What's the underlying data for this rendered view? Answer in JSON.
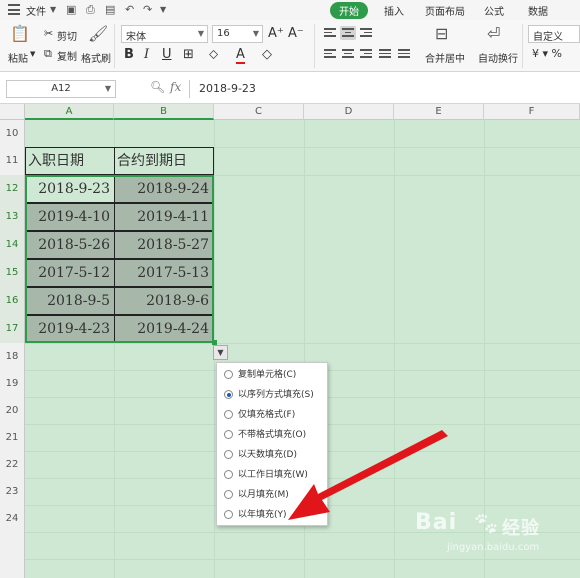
{
  "menubar": {
    "file_label": "文件",
    "tabs": [
      "开始",
      "插入",
      "页面布局",
      "公式",
      "数据"
    ]
  },
  "ribbon": {
    "paste_label": "粘贴",
    "cut_label": "剪切",
    "copy_label": "复制",
    "format_painter_label": "格式刷",
    "font_name": "宋体",
    "font_size": "16",
    "bold": "B",
    "italic": "I",
    "underline": "U",
    "merge_center_label": "合并居中",
    "wrap_text_label": "自动换行",
    "number_format": "自定义"
  },
  "formula_bar": {
    "name_box": "A12",
    "fx": "fx",
    "formula": "2018-9-23"
  },
  "columns": [
    "A",
    "B",
    "C",
    "D",
    "E",
    "F"
  ],
  "rows": [
    "10",
    "11",
    "12",
    "13",
    "14",
    "15",
    "16",
    "17",
    "18",
    "19",
    "20",
    "21",
    "22",
    "23",
    "24"
  ],
  "table": {
    "headers": [
      "入职日期",
      "合约到期日"
    ],
    "rows": [
      [
        "2018-9-23",
        "2018-9-24"
      ],
      [
        "2019-4-10",
        "2019-4-11"
      ],
      [
        "2018-5-26",
        "2018-5-27"
      ],
      [
        "2017-5-12",
        "2017-5-13"
      ],
      [
        "2018-9-5",
        "2018-9-6"
      ],
      [
        "2019-4-23",
        "2019-4-24"
      ]
    ]
  },
  "autofill_menu": {
    "options": [
      {
        "label": "复制单元格(C)",
        "selected": false
      },
      {
        "label": "以序列方式填充(S)",
        "selected": true
      },
      {
        "label": "仅填充格式(F)",
        "selected": false
      },
      {
        "label": "不带格式填充(O)",
        "selected": false
      },
      {
        "label": "以天数填充(D)",
        "selected": false
      },
      {
        "label": "以工作日填充(W)",
        "selected": false
      },
      {
        "label": "以月填充(M)",
        "selected": false
      },
      {
        "label": "以年填充(Y)",
        "selected": false
      }
    ]
  },
  "watermark": {
    "brand": "Bai",
    "brand2": "经验",
    "url": "jingyan.baidu.com"
  },
  "colors": {
    "accent": "#2e9b4b",
    "sheet_bg": "#cfe8d4",
    "selected_fill": "#a7b7aa",
    "arrow": "#e0161b"
  }
}
